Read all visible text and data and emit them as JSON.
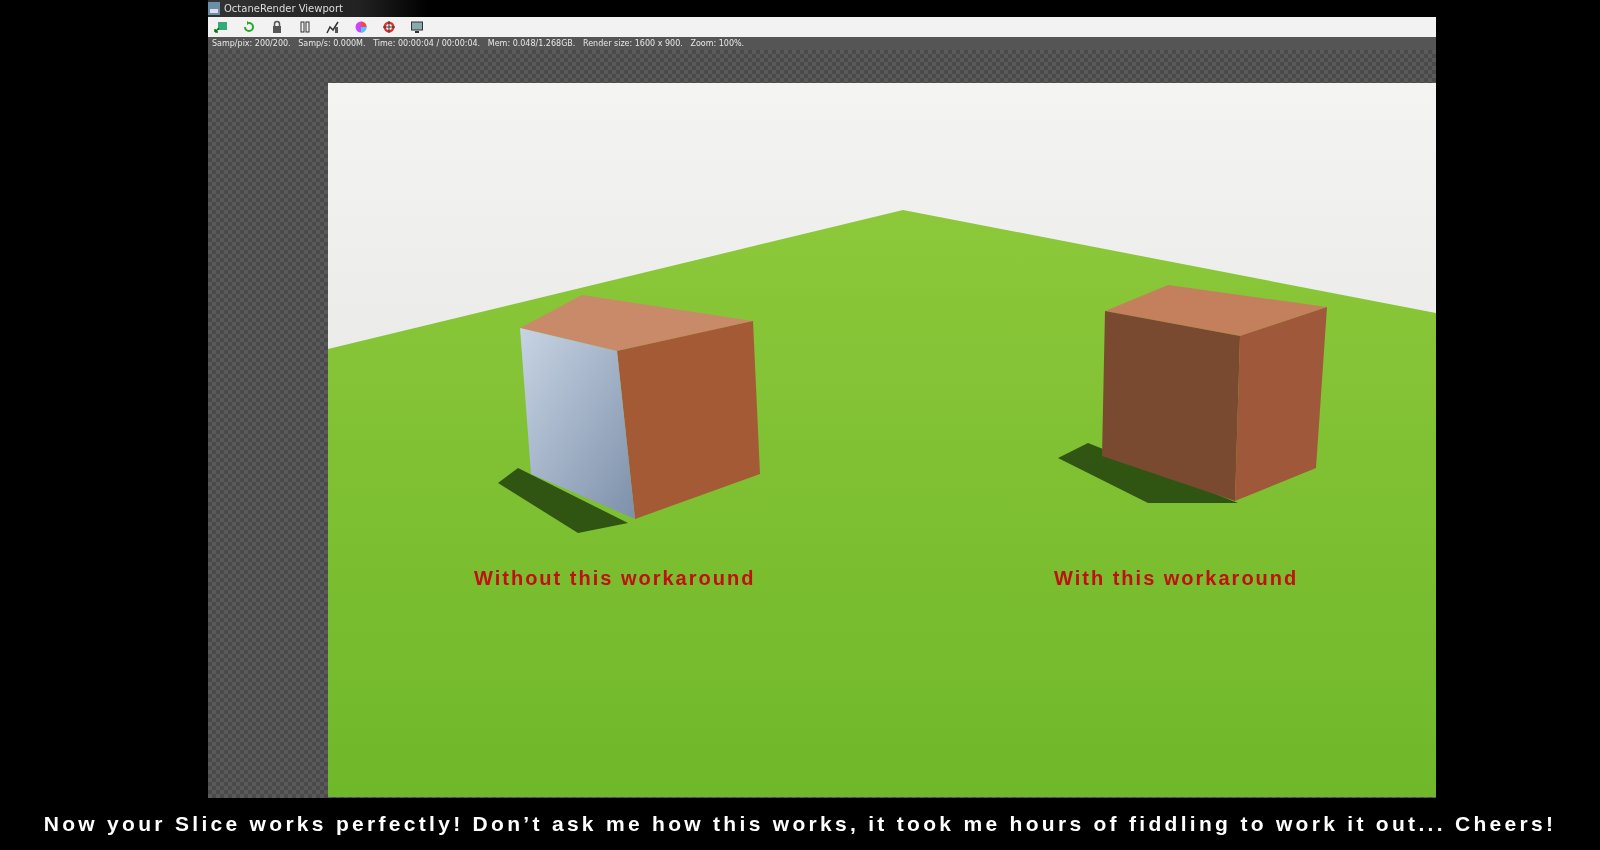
{
  "window": {
    "title": "OctaneRender Viewport"
  },
  "status_bar": "Samp/pix: 200/200.   Samp/s: 0.000M.   Time: 00:00:04 / 00:00:04.   Mem: 0.048/1.268GB.   Render size: 1600 x 900.   Zoom: 100%.",
  "render": {
    "labels": [
      "Without this workaround",
      "With this workaround"
    ]
  },
  "caption": "Now your Slice works perfectly! Don’t ask me how this works, it took me hours of fiddling to work it out... Cheers!"
}
